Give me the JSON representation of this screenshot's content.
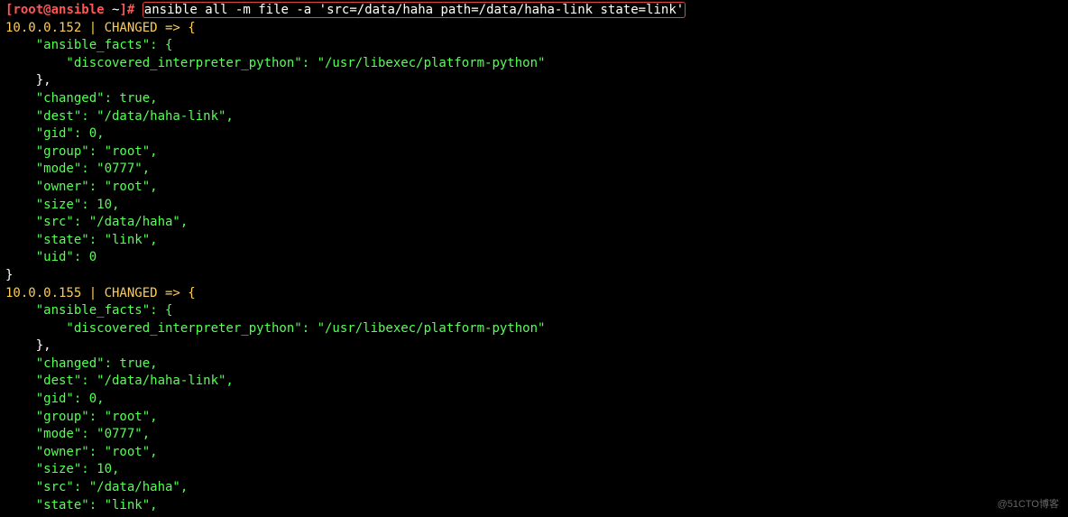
{
  "prompt": {
    "open": "[",
    "user": "root",
    "at": "@",
    "host": "ansible",
    "sep": " ",
    "tilde": "~",
    "close": "]",
    "hash": "# "
  },
  "command": "ansible all -m file -a 'src=/data/haha path=/data/haha-link state=link'",
  "hosts": [
    {
      "header": "10.0.0.152 | CHANGED => {",
      "facts_open": "    \"ansible_facts\": {",
      "facts_line": "        \"discovered_interpreter_python\": \"/usr/libexec/platform-python\"",
      "facts_close": "    },",
      "changed": "    \"changed\": true,",
      "dest": "    \"dest\": \"/data/haha-link\",",
      "gid": "    \"gid\": 0,",
      "group": "    \"group\": \"root\",",
      "mode": "    \"mode\": \"0777\",",
      "owner": "    \"owner\": \"root\",",
      "size": "    \"size\": 10,",
      "src": "    \"src\": \"/data/haha\",",
      "state": "    \"state\": \"link\",",
      "uid": "    \"uid\": 0",
      "close": "}"
    },
    {
      "header": "10.0.0.155 | CHANGED => {",
      "facts_open": "    \"ansible_facts\": {",
      "facts_line": "        \"discovered_interpreter_python\": \"/usr/libexec/platform-python\"",
      "facts_close": "    },",
      "changed": "    \"changed\": true,",
      "dest": "    \"dest\": \"/data/haha-link\",",
      "gid": "    \"gid\": 0,",
      "group": "    \"group\": \"root\",",
      "mode": "    \"mode\": \"0777\",",
      "owner": "    \"owner\": \"root\",",
      "size": "    \"size\": 10,",
      "src": "    \"src\": \"/data/haha\",",
      "state": "    \"state\": \"link\","
    }
  ],
  "watermark": "@51CTO博客"
}
